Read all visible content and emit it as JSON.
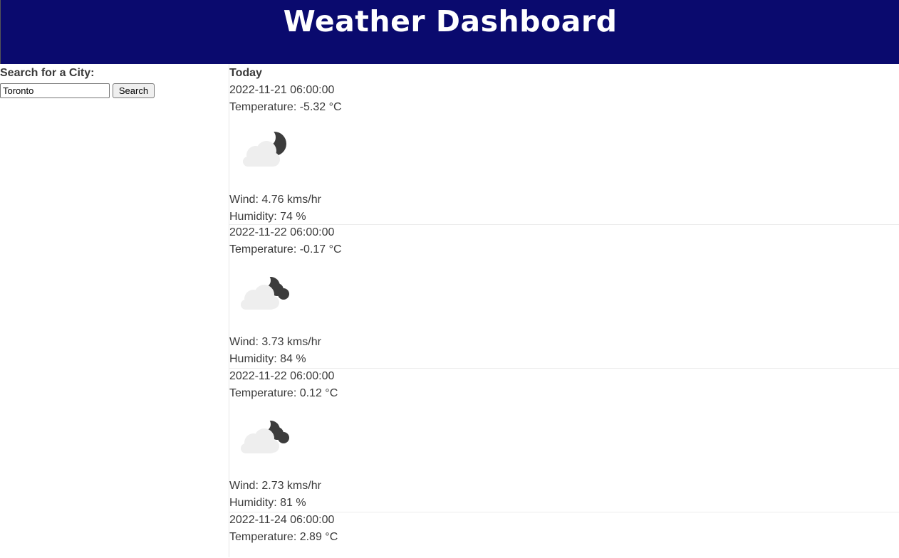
{
  "header": {
    "title": "Weather Dashboard"
  },
  "search": {
    "label": "Search for a City:",
    "value": "Toronto",
    "button_label": "Search"
  },
  "today": {
    "label": "Today"
  },
  "forecast": [
    {
      "date": "2022-11-21 06:00:00",
      "temperature": "Temperature: -5.32 °C",
      "icon": "partly-cloudy-night-icon",
      "wind": "Wind: 4.76 kms/hr",
      "humidity": "Humidity: 74 %"
    },
    {
      "date": "2022-11-22 06:00:00",
      "temperature": "Temperature: -0.17 °C",
      "icon": "cloudy-night-icon",
      "wind": "Wind: 3.73 kms/hr",
      "humidity": "Humidity: 84 %"
    },
    {
      "date": "2022-11-22 06:00:00",
      "temperature": "Temperature: 0.12 °C",
      "icon": "cloudy-night-icon",
      "wind": "Wind: 2.73 kms/hr",
      "humidity": "Humidity: 81 %"
    },
    {
      "date": "2022-11-24 06:00:00",
      "temperature": "Temperature: 2.89 °C"
    }
  ],
  "colors": {
    "header_bg": "#0a0a6e",
    "header_text": "#ffffff",
    "body_text": "#3a3a3a"
  }
}
